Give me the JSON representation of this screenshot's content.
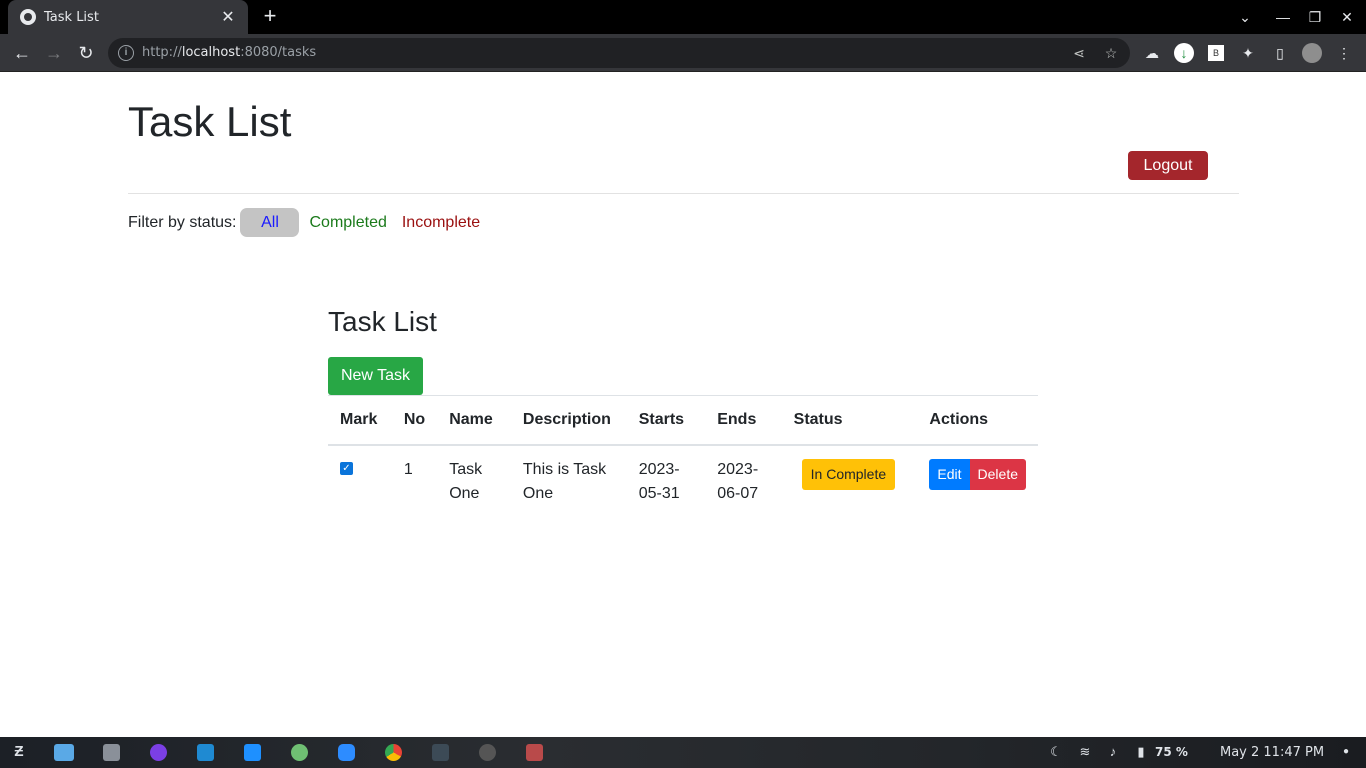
{
  "browser": {
    "tab_title": "Task  List",
    "tab_close": "✕",
    "new_tab": "+",
    "url_prefix": "http://",
    "url_host": "localhost",
    "url_rest": ":8080/tasks",
    "window_controls": [
      "⌄",
      "—",
      "❐",
      "✕"
    ]
  },
  "page": {
    "title": "Task List",
    "logout_label": "Logout",
    "filter": {
      "label": "Filter by status:",
      "options": [
        "All",
        "Completed",
        "Incomplete"
      ],
      "active": "All"
    }
  },
  "tasks_section": {
    "title": "Task List",
    "new_task_label": "New Task",
    "columns": [
      "Mark",
      "No",
      "Name",
      "Description",
      "Starts",
      "Ends",
      "Status",
      "Actions"
    ],
    "rows": [
      {
        "checked": true,
        "no": "1",
        "name": "Task One",
        "description": "This is Task One",
        "starts": "2023-05-31",
        "ends": "2023-06-07",
        "status": "In Complete",
        "edit_label": "Edit",
        "delete_label": "Delete"
      }
    ]
  },
  "taskbar": {
    "battery": "75 %",
    "datetime": "May 2  11:47 PM"
  },
  "colors": {
    "logout": "#a4262c",
    "new_task": "#28a745",
    "status_badge": "#ffc107",
    "edit": "#007bff",
    "delete": "#dc3545",
    "filter_all": "#1a1aff",
    "filter_completed": "#1b7a1b",
    "filter_incomplete": "#9a1010"
  }
}
